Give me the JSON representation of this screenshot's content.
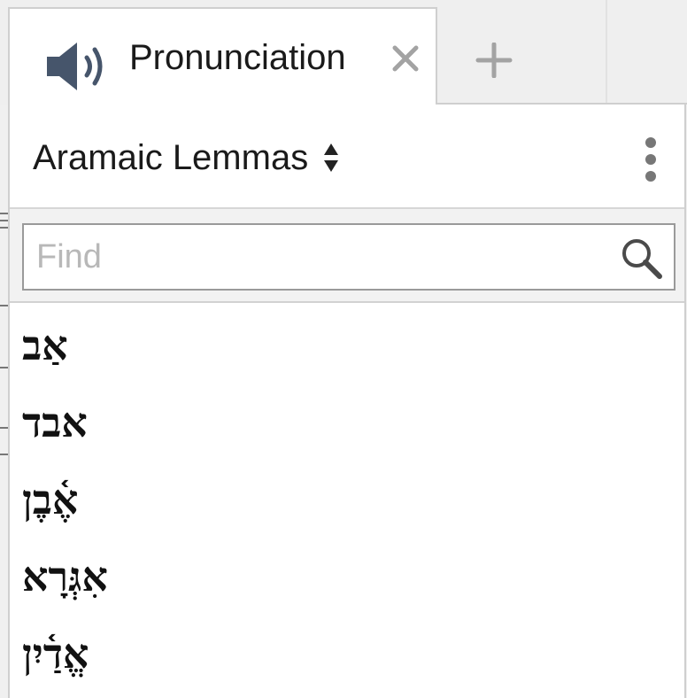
{
  "tab": {
    "title": "Pronunciation",
    "icon": "speaker-icon",
    "close_icon": "close-icon",
    "new_tab_icon": "plus-icon"
  },
  "resource": {
    "title": "Aramaic Lemmas",
    "picker_icon": "up-down-arrows-icon",
    "menu_icon": "kebab-menu-icon"
  },
  "search": {
    "placeholder": "Find",
    "value": "",
    "icon": "search-icon"
  },
  "lemmas": [
    "אַב",
    "אבד",
    "אֶ֫בֶן",
    "אִגְּרָא",
    "אֱדַ֫יִן"
  ],
  "colors": {
    "icon_dark": "#46556b",
    "icon_light": "#a3a3a3",
    "text": "#1a1a1a",
    "border": "#cfcfcf"
  }
}
